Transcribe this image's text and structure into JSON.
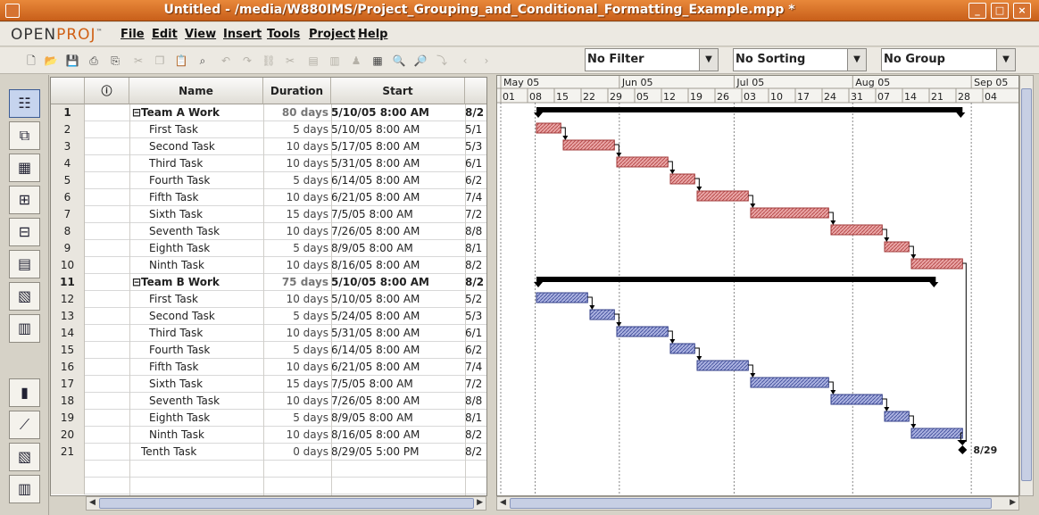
{
  "window": {
    "title": "Untitled - /media/W880IMS/Project_Grouping_and_Conditional_Formatting_Example.mpp *"
  },
  "app": {
    "logo_main": "OPEN",
    "logo_accent": "PROJ",
    "logo_tm": "™"
  },
  "menu": [
    "File",
    "Edit",
    "View",
    "Insert",
    "Tools",
    "Project",
    "Help"
  ],
  "filters": {
    "filter": "No Filter",
    "sorting": "No Sorting",
    "group": "No Group"
  },
  "columns": {
    "info": "ⓘ",
    "name": "Name",
    "duration": "Duration",
    "start": "Start"
  },
  "tasks": [
    {
      "id": "1",
      "name": "⊟Team A Work",
      "duration": "80 days",
      "start": "5/10/05 8:00 AM",
      "finish": "8/2",
      "summary": true
    },
    {
      "id": "2",
      "name": "First Task",
      "duration": "5 days",
      "start": "5/10/05 8:00 AM",
      "finish": "5/1"
    },
    {
      "id": "3",
      "name": "Second Task",
      "duration": "10 days",
      "start": "5/17/05 8:00 AM",
      "finish": "5/3"
    },
    {
      "id": "4",
      "name": "Third Task",
      "duration": "10 days",
      "start": "5/31/05 8:00 AM",
      "finish": "6/1"
    },
    {
      "id": "5",
      "name": "Fourth Task",
      "duration": "5 days",
      "start": "6/14/05 8:00 AM",
      "finish": "6/2"
    },
    {
      "id": "6",
      "name": "Fifth Task",
      "duration": "10 days",
      "start": "6/21/05 8:00 AM",
      "finish": "7/4"
    },
    {
      "id": "7",
      "name": "Sixth Task",
      "duration": "15 days",
      "start": "7/5/05 8:00 AM",
      "finish": "7/2"
    },
    {
      "id": "8",
      "name": "Seventh Task",
      "duration": "10 days",
      "start": "7/26/05 8:00 AM",
      "finish": "8/8"
    },
    {
      "id": "9",
      "name": "Eighth Task",
      "duration": "5 days",
      "start": "8/9/05 8:00 AM",
      "finish": "8/1"
    },
    {
      "id": "10",
      "name": "Ninth Task",
      "duration": "10 days",
      "start": "8/16/05 8:00 AM",
      "finish": "8/2"
    },
    {
      "id": "11",
      "name": "⊟Team B Work",
      "duration": "75 days",
      "start": "5/10/05 8:00 AM",
      "finish": "8/2",
      "summary": true
    },
    {
      "id": "12",
      "name": "First Task",
      "duration": "10 days",
      "start": "5/10/05 8:00 AM",
      "finish": "5/2"
    },
    {
      "id": "13",
      "name": "Second Task",
      "duration": "5 days",
      "start": "5/24/05 8:00 AM",
      "finish": "5/3"
    },
    {
      "id": "14",
      "name": "Third Task",
      "duration": "10 days",
      "start": "5/31/05 8:00 AM",
      "finish": "6/1"
    },
    {
      "id": "15",
      "name": "Fourth Task",
      "duration": "5 days",
      "start": "6/14/05 8:00 AM",
      "finish": "6/2"
    },
    {
      "id": "16",
      "name": "Fifth Task",
      "duration": "10 days",
      "start": "6/21/05 8:00 AM",
      "finish": "7/4"
    },
    {
      "id": "17",
      "name": "Sixth Task",
      "duration": "15 days",
      "start": "7/5/05 8:00 AM",
      "finish": "7/2"
    },
    {
      "id": "18",
      "name": "Seventh Task",
      "duration": "10 days",
      "start": "7/26/05 8:00 AM",
      "finish": "8/8"
    },
    {
      "id": "19",
      "name": "Eighth Task",
      "duration": "5 days",
      "start": "8/9/05 8:00 AM",
      "finish": "8/1"
    },
    {
      "id": "20",
      "name": "Ninth Task",
      "duration": "10 days",
      "start": "8/16/05 8:00 AM",
      "finish": "8/2"
    },
    {
      "id": "21",
      "name": "Tenth Task",
      "duration": "0 days",
      "start": "8/29/05 5:00 PM",
      "finish": "8/2"
    }
  ],
  "timeline": {
    "months": [
      "May 05",
      "Jun 05",
      "Jul 05",
      "Aug 05",
      "Sep 05"
    ],
    "days": [
      "01",
      "08",
      "15",
      "22",
      "29",
      "05",
      "12",
      "19",
      "26",
      "03",
      "10",
      "17",
      "24",
      "31",
      "07",
      "14",
      "21",
      "28",
      "04"
    ],
    "milestone_label": "8/29"
  },
  "colors": {
    "team_a_bar": "#d77878",
    "team_b_bar": "#7a86c8",
    "summary_bar": "#000000"
  }
}
